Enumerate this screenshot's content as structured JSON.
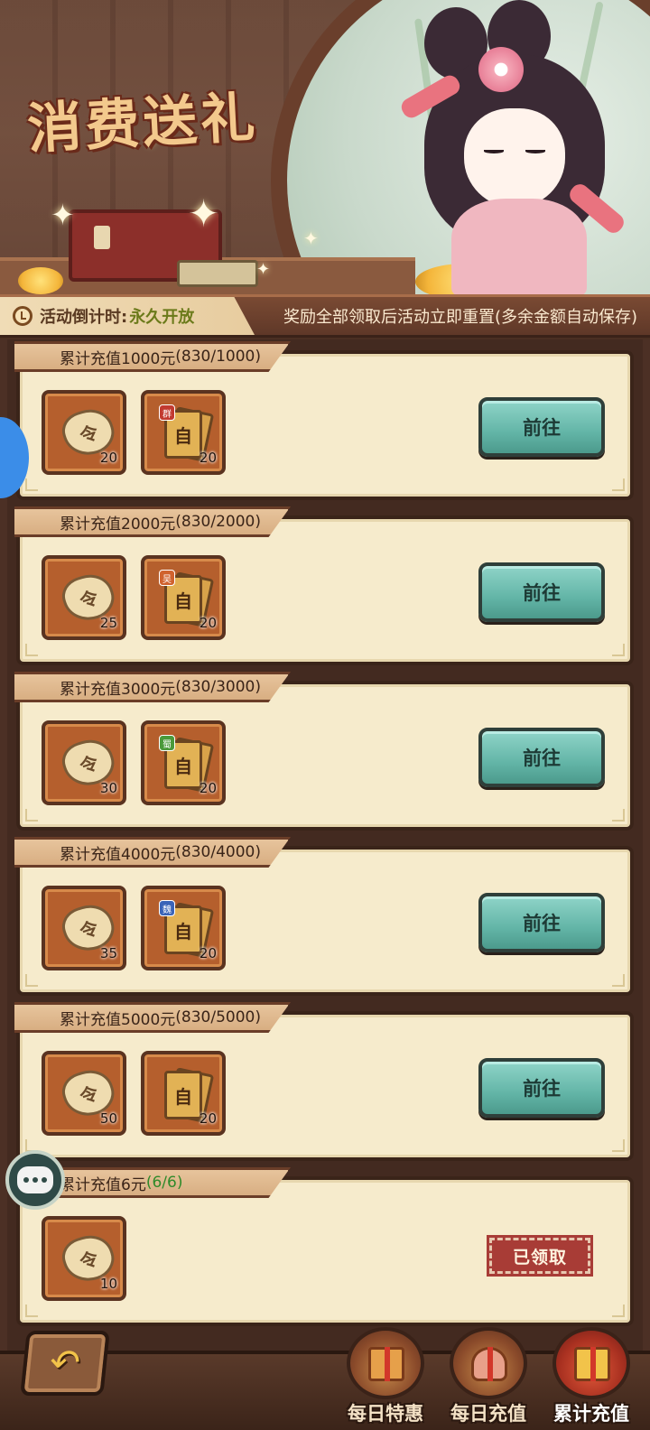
{
  "banner": {
    "title": "消费送礼"
  },
  "timer": {
    "label": "活动倒计时:",
    "value": "永久开放",
    "notice": "奖励全部领取后活动立即重置(多余金额自动保存)"
  },
  "tasks": [
    {
      "title": "累计充值1000元",
      "progress": "(830/1000)",
      "rewards": [
        {
          "icon": "token-icon",
          "glyph": "令",
          "count": "20"
        },
        {
          "icon": "card-icon",
          "glyph": "自",
          "tag": "群",
          "tag_color": "#c23a30",
          "count": "20"
        }
      ],
      "button": "前往"
    },
    {
      "title": "累计充值2000元",
      "progress": "(830/2000)",
      "rewards": [
        {
          "icon": "token-icon",
          "glyph": "令",
          "count": "25"
        },
        {
          "icon": "card-icon",
          "glyph": "自",
          "tag": "吴",
          "tag_color": "#d0622e",
          "count": "20"
        }
      ],
      "button": "前往"
    },
    {
      "title": "累计充值3000元",
      "progress": "(830/3000)",
      "rewards": [
        {
          "icon": "token-icon",
          "glyph": "令",
          "count": "30"
        },
        {
          "icon": "card-icon",
          "glyph": "自",
          "tag": "蜀",
          "tag_color": "#4a9a3a",
          "count": "20"
        }
      ],
      "button": "前往"
    },
    {
      "title": "累计充值4000元",
      "progress": "(830/4000)",
      "rewards": [
        {
          "icon": "token-icon",
          "glyph": "令",
          "count": "35"
        },
        {
          "icon": "card-icon",
          "glyph": "自",
          "tag": "魏",
          "tag_color": "#3a64b8",
          "count": "20"
        }
      ],
      "button": "前往"
    },
    {
      "title": "累计充值5000元",
      "progress": "(830/5000)",
      "rewards": [
        {
          "icon": "token-icon",
          "glyph": "令",
          "count": "50"
        },
        {
          "icon": "card-icon",
          "glyph": "自",
          "count": "20"
        }
      ],
      "button": "前往"
    },
    {
      "title": "累计充值6元",
      "progress": "(6/6)",
      "rewards": [
        {
          "icon": "token-icon",
          "glyph": "令",
          "count": "10"
        }
      ],
      "status": "已领取"
    }
  ],
  "nav": {
    "back_icon": "back-arrow-icon",
    "back_glyph": "↶",
    "tabs": [
      {
        "label": "每日特惠"
      },
      {
        "label": "每日充值"
      },
      {
        "label": "累计充值",
        "active": true
      }
    ]
  },
  "chat_icon": "chat-bubble-icon"
}
